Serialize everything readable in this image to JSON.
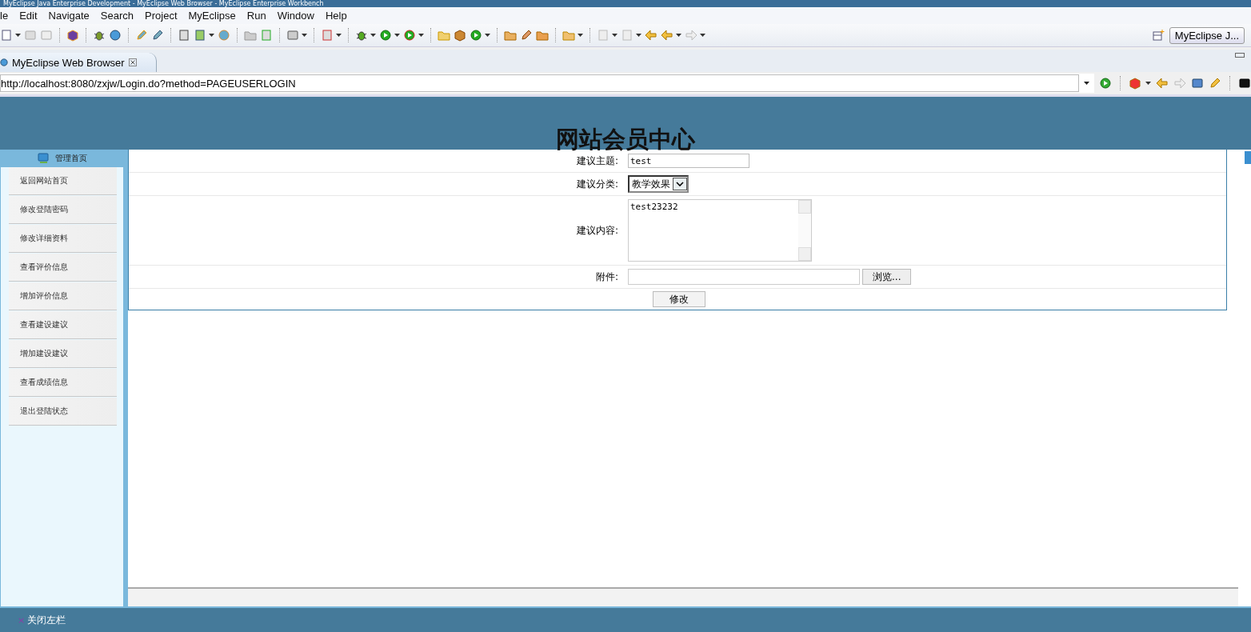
{
  "window": {
    "title": "MyEclipse Java Enterprise Development - MyEclipse Web Browser - MyEclipse Enterprise Workbench"
  },
  "menu": [
    "le",
    "Edit",
    "Navigate",
    "Search",
    "Project",
    "MyEclipse",
    "Run",
    "Window",
    "Help"
  ],
  "perspective": {
    "label": "MyEclipse J..."
  },
  "tabs": [
    {
      "label": "MyEclipse Web Browser",
      "selected": true
    }
  ],
  "address": {
    "value": "http://localhost:8080/zxjw/Login.do?method=PAGEUSERLOGIN"
  },
  "page": {
    "title": "网站会员中心",
    "sidebar": {
      "header": "管理首页",
      "items": [
        {
          "label": "返回网站首页"
        },
        {
          "label": "修改登陆密码"
        },
        {
          "label": "修改详细资料"
        },
        {
          "label": "查看评价信息"
        },
        {
          "label": "增加评价信息"
        },
        {
          "label": "查看建设建议"
        },
        {
          "label": "增加建设建议"
        },
        {
          "label": "查看成绩信息"
        },
        {
          "label": "退出登陆状态"
        }
      ]
    },
    "form": {
      "fields": [
        {
          "kind": "text",
          "label": "建议主题:",
          "value": "test"
        },
        {
          "kind": "select",
          "label": "建议分类:",
          "value": "教学效果"
        },
        {
          "kind": "textarea",
          "label": "建议内容:",
          "value": "test23232"
        },
        {
          "kind": "file",
          "label": "附件:",
          "button": "浏览..."
        }
      ],
      "submit": "修改"
    },
    "footer": {
      "icon": "×",
      "label": "关闭左栏"
    }
  }
}
